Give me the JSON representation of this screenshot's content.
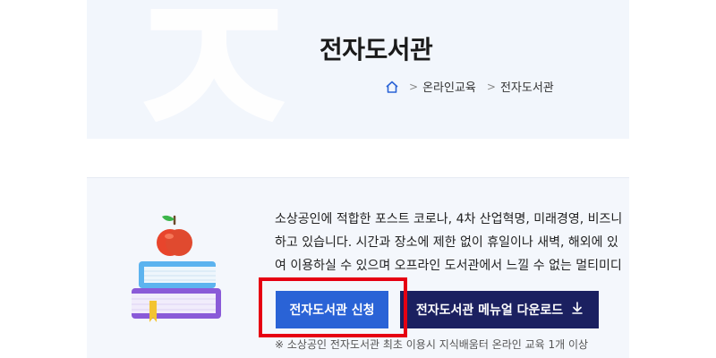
{
  "hero": {
    "watermark_char": "ㅈ",
    "title": "전자도서관",
    "breadcrumb": [
      "온라인교육",
      "전자도서관"
    ]
  },
  "content": {
    "description_lines": [
      "소상공인에 적합한 포스트 코로나, 4차 산업혁명, 미래경영, 비즈니",
      "하고 있습니다. 시간과 장소에 제한 없이 휴일이나 새벽, 해외에 있",
      "여 이용하실 수 있으며 오프라인 도서관에서 느낄 수 없는 멀티미디"
    ],
    "apply_button_label": "전자도서관 신청",
    "manual_button_label": "전자도서관 메뉴얼 다운로드",
    "download_icon": "↓",
    "note": "※ 소상공인 전자도서관 최초 이용시 지식배움터 온라인 교육 1개 이상"
  },
  "icons": {
    "home": "home-icon",
    "download": "download-icon",
    "books": "books-apple-illustration"
  },
  "colors": {
    "hero_bg": "#f2f6fc",
    "card_bg": "#f4f7fc",
    "apply_button": "#2a63d6",
    "manual_button": "#1b2060",
    "highlight_border": "#e60012"
  }
}
